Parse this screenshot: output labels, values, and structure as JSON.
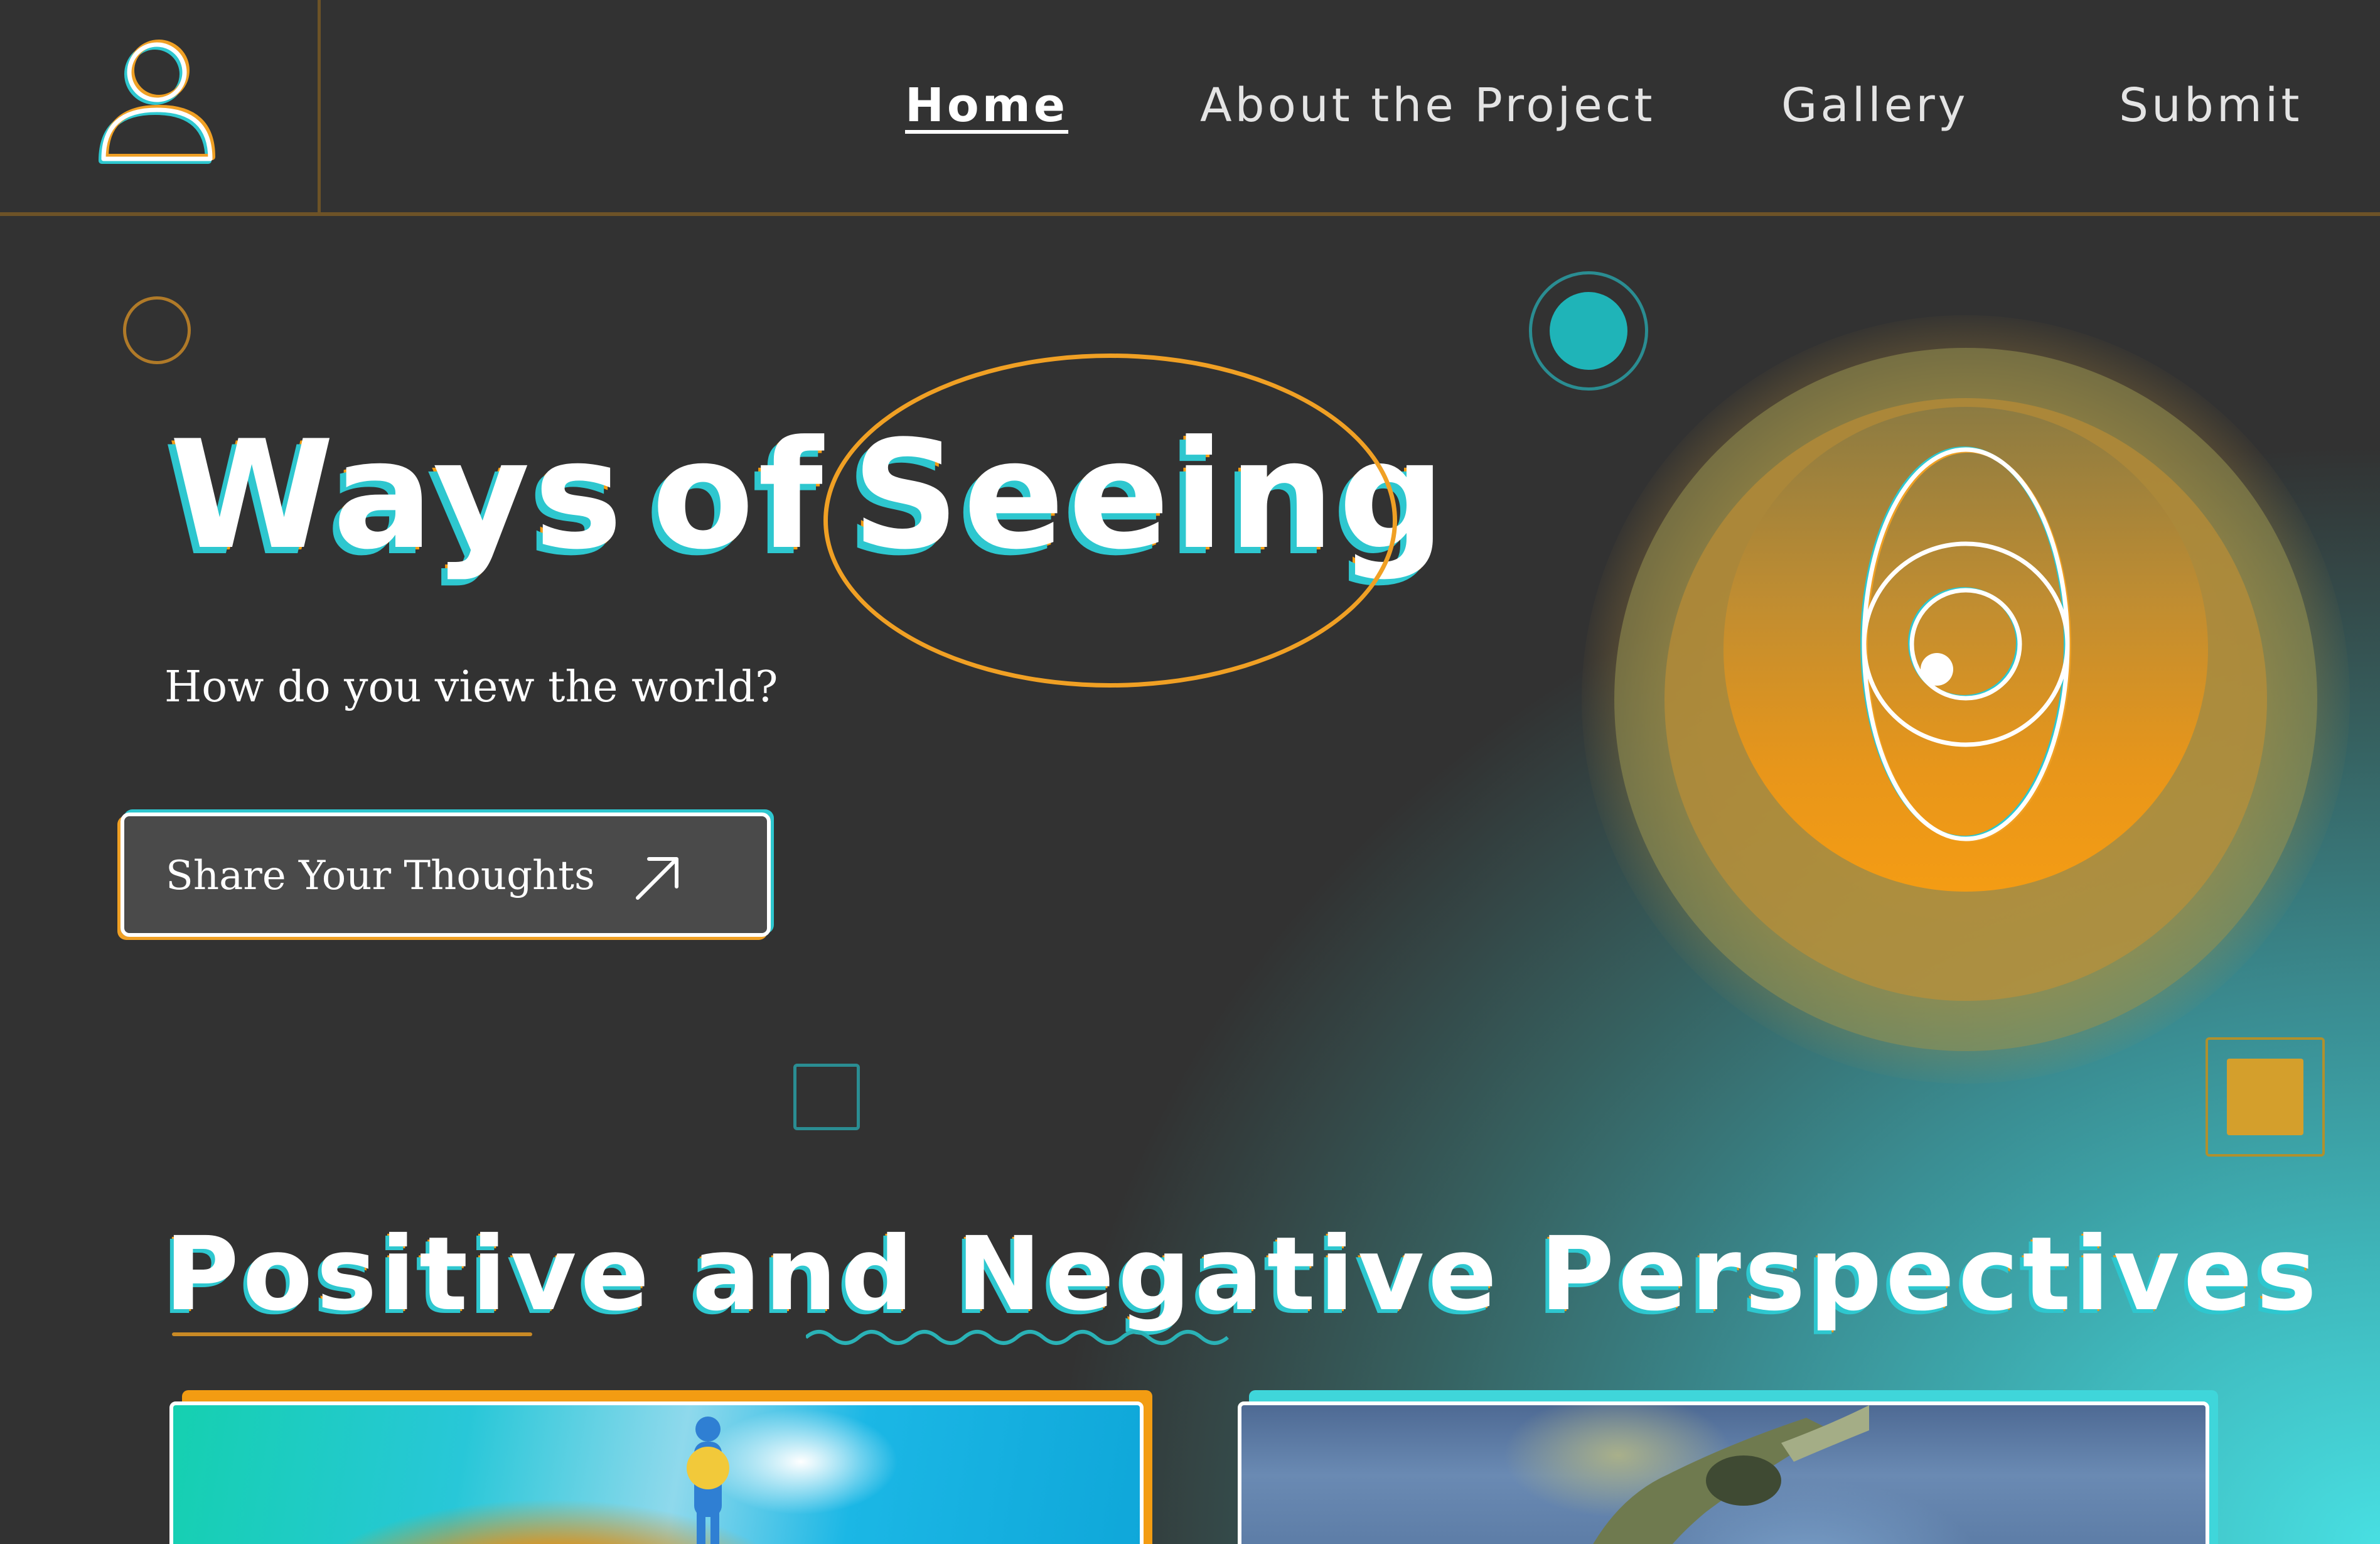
{
  "nav": {
    "avatar_icon": "user-icon",
    "links": [
      {
        "label": "Home",
        "active": true
      },
      {
        "label": "About the Project",
        "active": false
      },
      {
        "label": "Gallery",
        "active": false
      },
      {
        "label": "Submit",
        "active": false
      }
    ]
  },
  "hero": {
    "title_part1": "Ways",
    "title_part2": "of",
    "title_highlight": "Seeing",
    "subtitle": "How do you view the world?",
    "cta_label": "Share Your Thoughts",
    "cta_icon": "arrow-up-right-icon",
    "eye_icon": "eye-icon"
  },
  "section": {
    "title_word1": "Positive",
    "title_word2": "and",
    "title_word3": "Negative",
    "title_word4": "Perspectives"
  },
  "colors": {
    "accent_orange": "#f39c12",
    "accent_teal": "#2ec7cf",
    "background_dark": "#323232",
    "background_teal": "#48dfe2"
  }
}
